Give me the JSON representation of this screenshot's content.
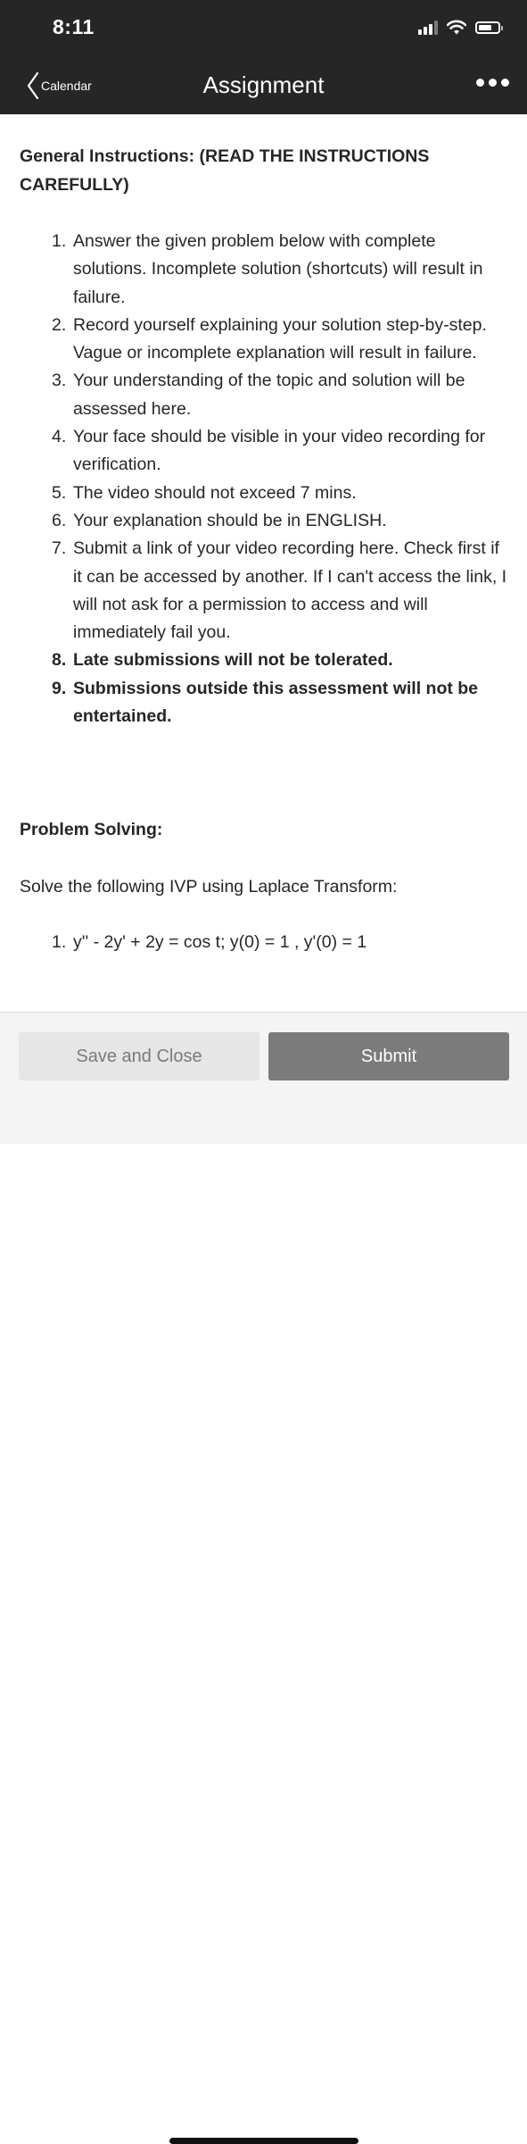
{
  "status_bar": {
    "time": "8:11"
  },
  "nav": {
    "back_label": "Calendar",
    "title": "Assignment"
  },
  "instructions": {
    "heading": "General Instructions: (READ THE INSTRUCTIONS CAREFULLY)",
    "items": [
      {
        "num": "1.",
        "text": "Answer the given problem below with complete solutions. Incomplete solution (shortcuts) will result in failure."
      },
      {
        "num": "2.",
        "text": "Record yourself explaining your solution step-by-step. Vague or incomplete explanation will result in failure."
      },
      {
        "num": "3.",
        "text": "Your understanding of the topic and solution will be assessed here."
      },
      {
        "num": "4.",
        "text": "Your face should be visible in your video recording for verification."
      },
      {
        "num": "5.",
        "text": "The video should not exceed 7 mins."
      },
      {
        "num": "6.",
        "text": "Your explanation should be in ENGLISH."
      },
      {
        "num": "7.",
        "text": "Submit a link of your video recording here. Check first if it can be accessed by another. If I can't access the link, I will not ask for a permission to access and will immediately fail you."
      },
      {
        "num": "8.",
        "text": "Late submissions will not be tolerated."
      },
      {
        "num": "9.",
        "text": "Submissions outside this assessment will not be entertained."
      }
    ]
  },
  "problem": {
    "heading": "Problem Solving:",
    "intro": "Solve the following IVP using Laplace Transform:",
    "items": [
      {
        "num": "1.",
        "text": "y'' - 2y' + 2y = cos t; y(0) = 1 , y'(0) = 1"
      }
    ]
  },
  "actions": {
    "save_label": "Save and Close",
    "submit_label": "Submit"
  },
  "icons": {
    "back": "chevron-left-icon",
    "more": "more-horizontal-icon",
    "signal": "cellular-signal-icon",
    "wifi": "wifi-icon",
    "battery": "battery-icon"
  },
  "colors": {
    "bar_background": "#262626",
    "submit_button": "#7b7b7b",
    "save_button": "#e6e6e6"
  }
}
